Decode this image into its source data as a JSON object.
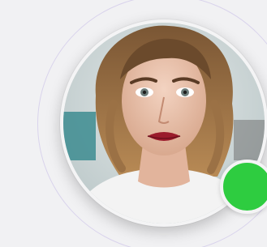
{
  "avatar": {
    "icon": "person-portrait",
    "description_hidden": ""
  },
  "status": {
    "state": "online",
    "color": "#2ecc40"
  },
  "colors": {
    "background": "#f1f1f3",
    "ring": "#d9d3ec"
  }
}
